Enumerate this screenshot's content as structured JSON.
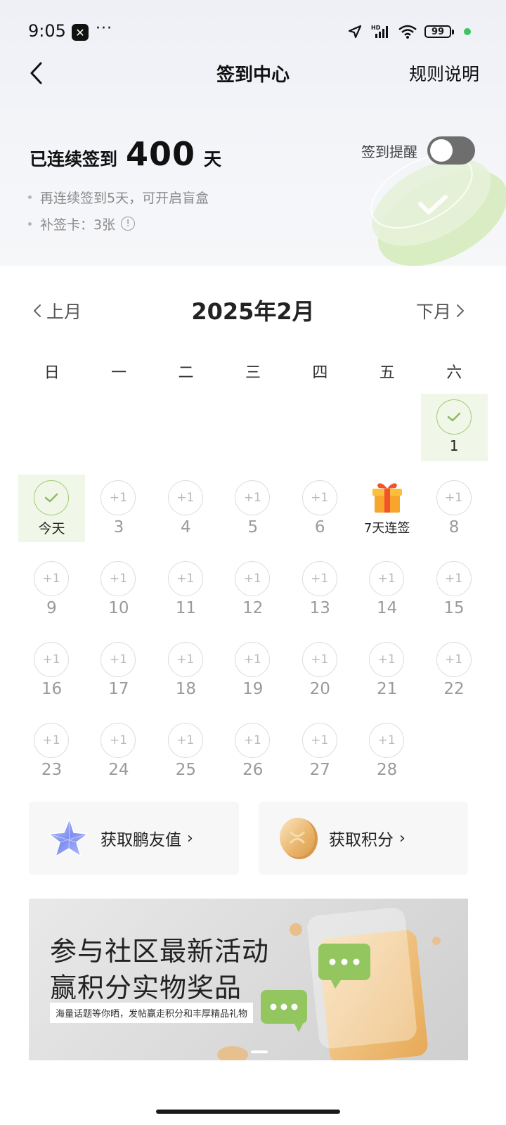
{
  "status_bar": {
    "time": "9:05",
    "app_icon": "x-app-icon",
    "battery": "99",
    "dots": "···"
  },
  "nav": {
    "title": "签到中心",
    "rules": "规则说明",
    "back_icon": "chevron-left-icon"
  },
  "streak": {
    "prefix": "已连续签到",
    "days": "400",
    "unit": "天"
  },
  "reminder": {
    "label": "签到提醒",
    "enabled": false
  },
  "info": {
    "line1": "再连续签到5天，可开启盲盒",
    "line2": "补签卡：3张"
  },
  "calendar": {
    "prev": "上月",
    "next": "下月",
    "month": "2025年2月",
    "weekdays": [
      "日",
      "一",
      "二",
      "三",
      "四",
      "五",
      "六"
    ],
    "plus_label": "+1",
    "days": [
      "1",
      "今天",
      "3",
      "4",
      "5",
      "6",
      "7天连签",
      "8",
      "9",
      "10",
      "11",
      "12",
      "13",
      "14",
      "15",
      "16",
      "17",
      "18",
      "19",
      "20",
      "21",
      "22",
      "23",
      "24",
      "25",
      "26",
      "27",
      "28"
    ]
  },
  "cards": {
    "friend_value": "获取鹏友值",
    "points": "获取积分"
  },
  "banner": {
    "title1": "参与社区最新活动",
    "title2": "赢积分实物奖品",
    "subtitle": "海量话题等你晒，发帖赢走积分和丰厚精品礼物"
  },
  "colors": {
    "checked_bg": "#f1f7e8",
    "checked_ring": "#9fc974",
    "toggle_off": "#6e6e6e"
  }
}
